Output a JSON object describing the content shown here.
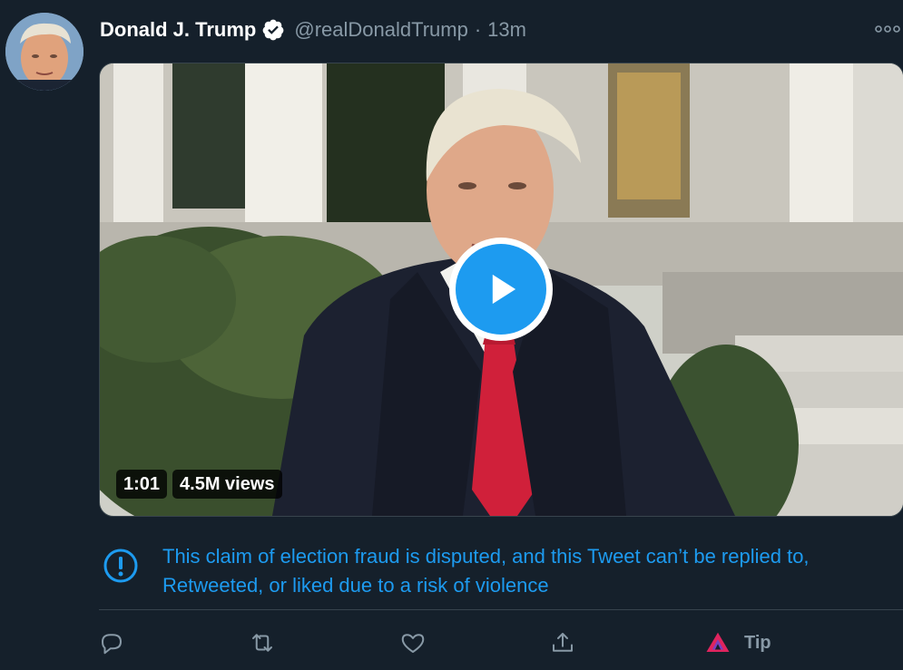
{
  "tweet": {
    "author_name": "Donald J. Trump",
    "handle": "@realDonaldTrump",
    "separator": "·",
    "time": "13m",
    "verified": true
  },
  "media": {
    "duration": "1:01",
    "views": "4.5M views"
  },
  "notice": {
    "text": "This claim of election fraud is disputed, and this Tweet can’t be replied to, Retweeted, or liked due to a risk of violence"
  },
  "actions": {
    "tip_label": "Tip"
  },
  "icons": {
    "verified": "verified-badge-icon",
    "more": "more-icon",
    "play": "play-icon",
    "notice": "exclamation-circle-icon",
    "reply": "reply-icon",
    "retweet": "retweet-icon",
    "like": "heart-icon",
    "share": "share-icon",
    "tip": "tip-icon"
  },
  "colors": {
    "background": "#15202b",
    "accent": "#1d9bf0",
    "muted": "#8899a6"
  }
}
